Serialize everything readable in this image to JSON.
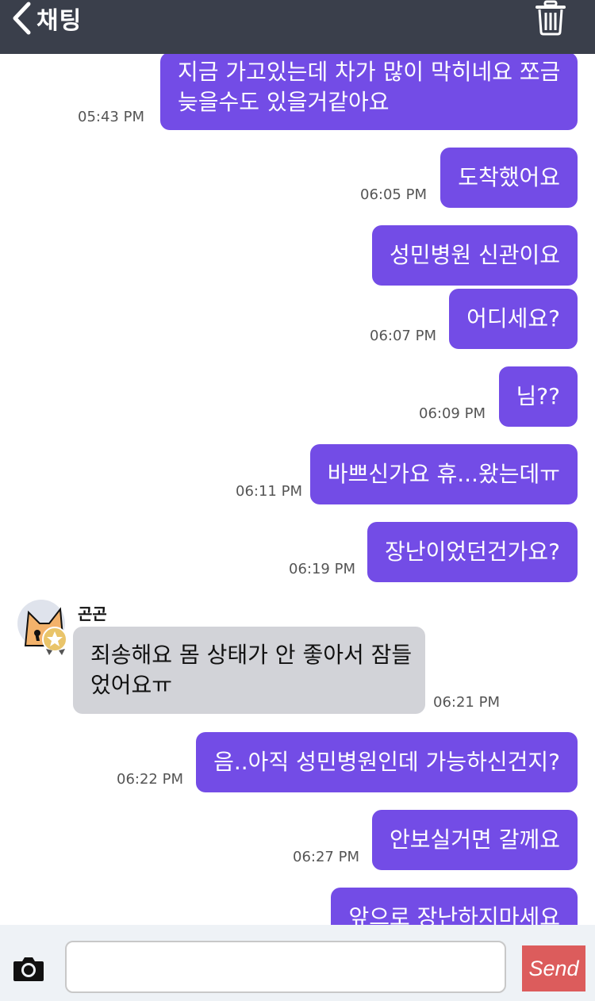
{
  "header": {
    "back_label": "채팅"
  },
  "messages": [
    {
      "dir": "out",
      "lines": [
        "지금 가고있는데 차가 많이 막히네요 쪼금",
        "늦을수도 있을거같아요"
      ],
      "time": "05:43 PM"
    },
    {
      "dir": "out",
      "lines": [
        "도착했어요"
      ],
      "time": "06:05 PM"
    },
    {
      "dir": "out",
      "lines": [
        "성민병원 신관이요"
      ],
      "time": ""
    },
    {
      "dir": "out",
      "lines": [
        "어디세요?"
      ],
      "time": "06:07 PM"
    },
    {
      "dir": "out",
      "lines": [
        "님??"
      ],
      "time": "06:09 PM"
    },
    {
      "dir": "out",
      "lines": [
        "바쁘신가요 휴...왔는데ㅠ"
      ],
      "time": "06:11 PM"
    },
    {
      "dir": "out",
      "lines": [
        "장난이었던건가요?"
      ],
      "time": "06:19 PM"
    },
    {
      "dir": "in",
      "sender": "곤곤",
      "lines": [
        "죄송해요 몸 상태가 안 좋아서 잠들",
        "었어요ㅠ"
      ],
      "time": "06:21 PM"
    },
    {
      "dir": "out",
      "lines": [
        "음..아직 성민병원인데 가능하신건지?"
      ],
      "time": "06:22 PM"
    },
    {
      "dir": "out",
      "lines": [
        "안보실거면 갈께요"
      ],
      "time": "06:27 PM"
    },
    {
      "dir": "out",
      "lines": [
        "앞으로 장난하지마세요"
      ],
      "time": ""
    }
  ],
  "composer": {
    "placeholder": "",
    "send_label": "Send"
  },
  "colors": {
    "header": "#3a3f4b",
    "outgoing_bubble": "#734ce6",
    "incoming_bubble": "#d2d3d8",
    "send_button": "#dc5c5c"
  }
}
